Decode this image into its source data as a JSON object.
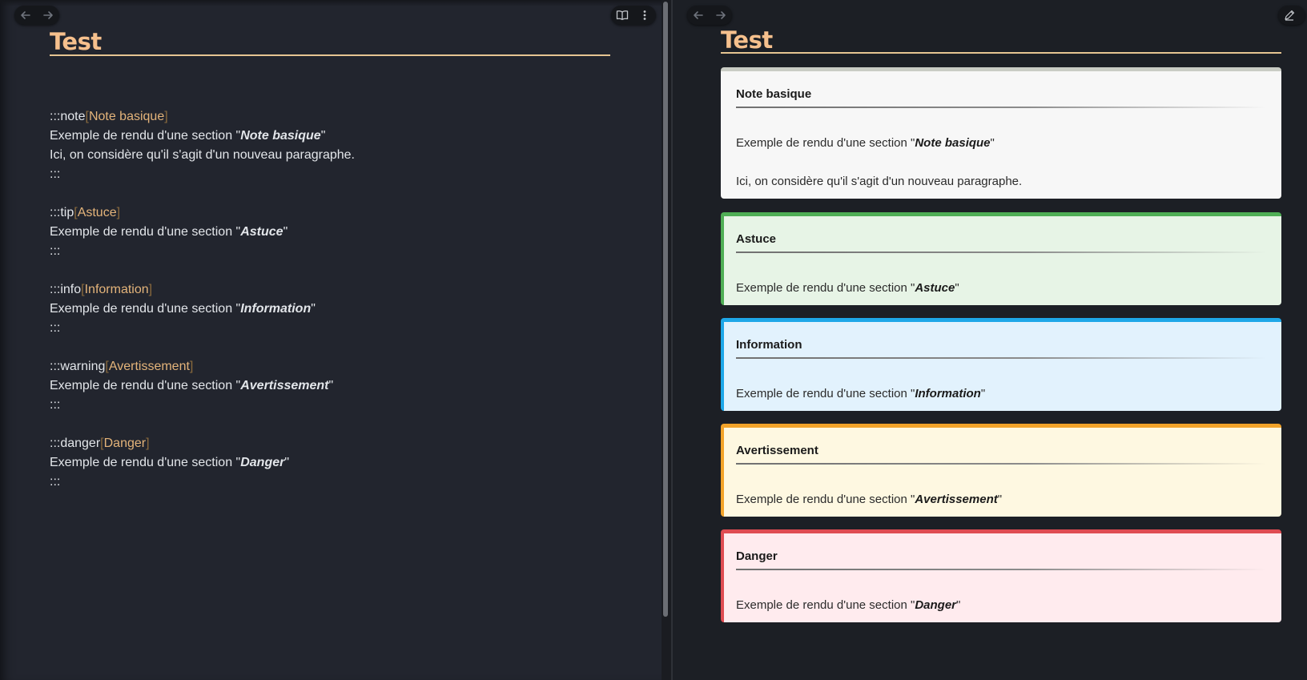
{
  "editor": {
    "title": "Test",
    "blocks": [
      {
        "directive": ":::note",
        "attr": "Note basique",
        "text_before": "Exemple de rendu d'une section \"",
        "emphasis": "Note basique",
        "text_after": "\"",
        "extra_line": "Ici, on considère qu'il s'agit d'un nouveau paragraphe.",
        "close": ":::"
      },
      {
        "directive": ":::tip",
        "attr": "Astuce",
        "text_before": "Exemple de rendu d'une section \"",
        "emphasis": "Astuce",
        "text_after": "\"",
        "close": ":::"
      },
      {
        "directive": ":::info",
        "attr": "Information",
        "text_before": "Exemple de rendu d'une section \"",
        "emphasis": "Information",
        "text_after": "\"",
        "close": ":::"
      },
      {
        "directive": ":::warning",
        "attr": "Avertissement",
        "text_before": "Exemple de rendu d'une section \"",
        "emphasis": "Avertissement",
        "text_after": "\"",
        "close": ":::"
      },
      {
        "directive": ":::danger",
        "attr": "Danger",
        "text_before": "Exemple de rendu d'une section \"",
        "emphasis": "Danger",
        "text_after": "\"",
        "close": ":::"
      }
    ],
    "bracket_open": "[",
    "bracket_close": "]",
    "icons": {
      "back": "arrow-left-icon",
      "forward": "arrow-right-icon",
      "reading_view": "book-open-icon",
      "more": "more-options-icon"
    }
  },
  "preview": {
    "title": "Test",
    "callouts": [
      {
        "type": "note",
        "title": "Note basique",
        "text_before": "Exemple de rendu d'une section \"",
        "emphasis": "Note basique",
        "text_after": "\"",
        "paragraph2": "Ici, on considère qu'il s'agit d'un nouveau paragraphe.",
        "accent": "#c9ccc4",
        "background": "#f7f7f7"
      },
      {
        "type": "tip",
        "title": "Astuce",
        "text_before": "Exemple de rendu d'une section \"",
        "emphasis": "Astuce",
        "text_after": "\"",
        "accent": "#4fae55",
        "background": "#e7f4e6"
      },
      {
        "type": "info",
        "title": "Information",
        "text_before": "Exemple de rendu d'une section \"",
        "emphasis": "Information",
        "text_after": "\"",
        "accent": "#1ea7e8",
        "background": "#e2f2fd"
      },
      {
        "type": "warning",
        "title": "Avertissement",
        "text_before": "Exemple de rendu d'une section \"",
        "emphasis": "Avertissement",
        "text_after": "\"",
        "accent": "#f2a32a",
        "background": "#fef8e1"
      },
      {
        "type": "danger",
        "title": "Danger",
        "text_before": "Exemple de rendu d'une section \"",
        "emphasis": "Danger",
        "text_after": "\"",
        "accent": "#df4c52",
        "background": "#ffebee"
      }
    ],
    "icons": {
      "back": "arrow-left-icon",
      "forward": "arrow-right-icon",
      "edit": "pencil-icon"
    }
  },
  "theme": {
    "title_color": "#f6c08d",
    "editor_bg": "#22252e",
    "preview_bg": "#1c1f25"
  }
}
